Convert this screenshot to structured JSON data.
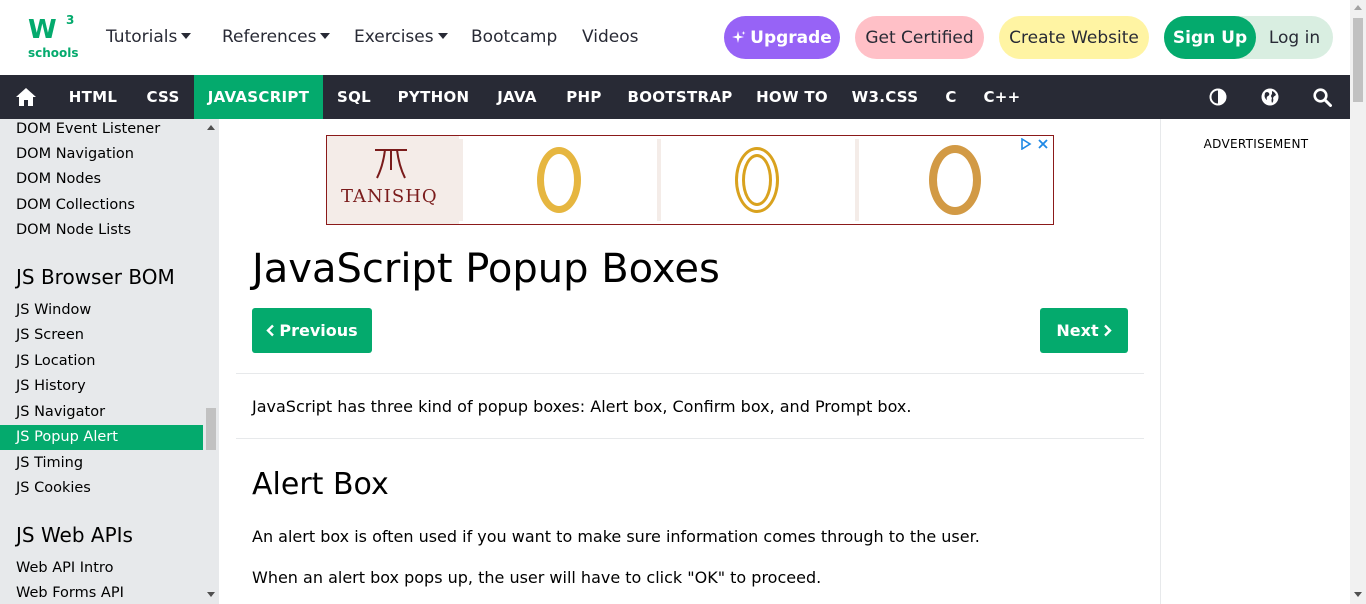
{
  "logo": {
    "mark": "W",
    "superscript": "3",
    "text": "schools"
  },
  "topnav": {
    "tutorials": "Tutorials",
    "references": "References",
    "exercises": "Exercises",
    "bootcamp": "Bootcamp",
    "videos": "Videos"
  },
  "buttons": {
    "upgrade": "Upgrade",
    "get_certified": "Get Certified",
    "create_website": "Create Website",
    "sign_up": "Sign Up",
    "log_in": "Log in"
  },
  "darknav": {
    "items": [
      "HTML",
      "CSS",
      "JAVASCRIPT",
      "SQL",
      "PYTHON",
      "JAVA",
      "PHP",
      "BOOTSTRAP",
      "HOW TO",
      "W3.CSS",
      "C",
      "C++"
    ],
    "active": "JAVASCRIPT"
  },
  "sidebar": {
    "dom_items": [
      "DOM Event Listener",
      "DOM Navigation",
      "DOM Nodes",
      "DOM Collections",
      "DOM Node Lists"
    ],
    "bom_heading": "JS Browser BOM",
    "bom_items": [
      "JS Window",
      "JS Screen",
      "JS Location",
      "JS History",
      "JS Navigator",
      "JS Popup Alert",
      "JS Timing",
      "JS Cookies"
    ],
    "active": "JS Popup Alert",
    "webapi_heading": "JS Web APIs",
    "webapi_items": [
      "Web API Intro",
      "Web Forms API"
    ]
  },
  "ad": {
    "brand": "TANISHQ"
  },
  "main": {
    "title": "JavaScript Popup Boxes",
    "prev": "Previous",
    "next": "Next",
    "intro": "JavaScript has three kind of popup boxes: Alert box, Confirm box, and Prompt box.",
    "alert_heading": "Alert Box",
    "alert_p1": "An alert box is often used if you want to make sure information comes through to the user.",
    "alert_p2": "When an alert box pops up, the user will have to click \"OK\" to proceed."
  },
  "rightcol": {
    "ad_label": "ADVERTISEMENT"
  },
  "colors": {
    "accent": "#04AA6D",
    "dark_nav": "#282A35",
    "upgrade": "#9763F6",
    "certified": "#FFC0C7",
    "create": "#FFF4A3",
    "sidebar": "#E7E9EB"
  },
  "icons": [
    "home-icon",
    "contrast-icon",
    "globe-icon",
    "search-icon",
    "sparkle-icon",
    "chevron-left-icon",
    "chevron-right-icon",
    "adchoices-icon"
  ]
}
